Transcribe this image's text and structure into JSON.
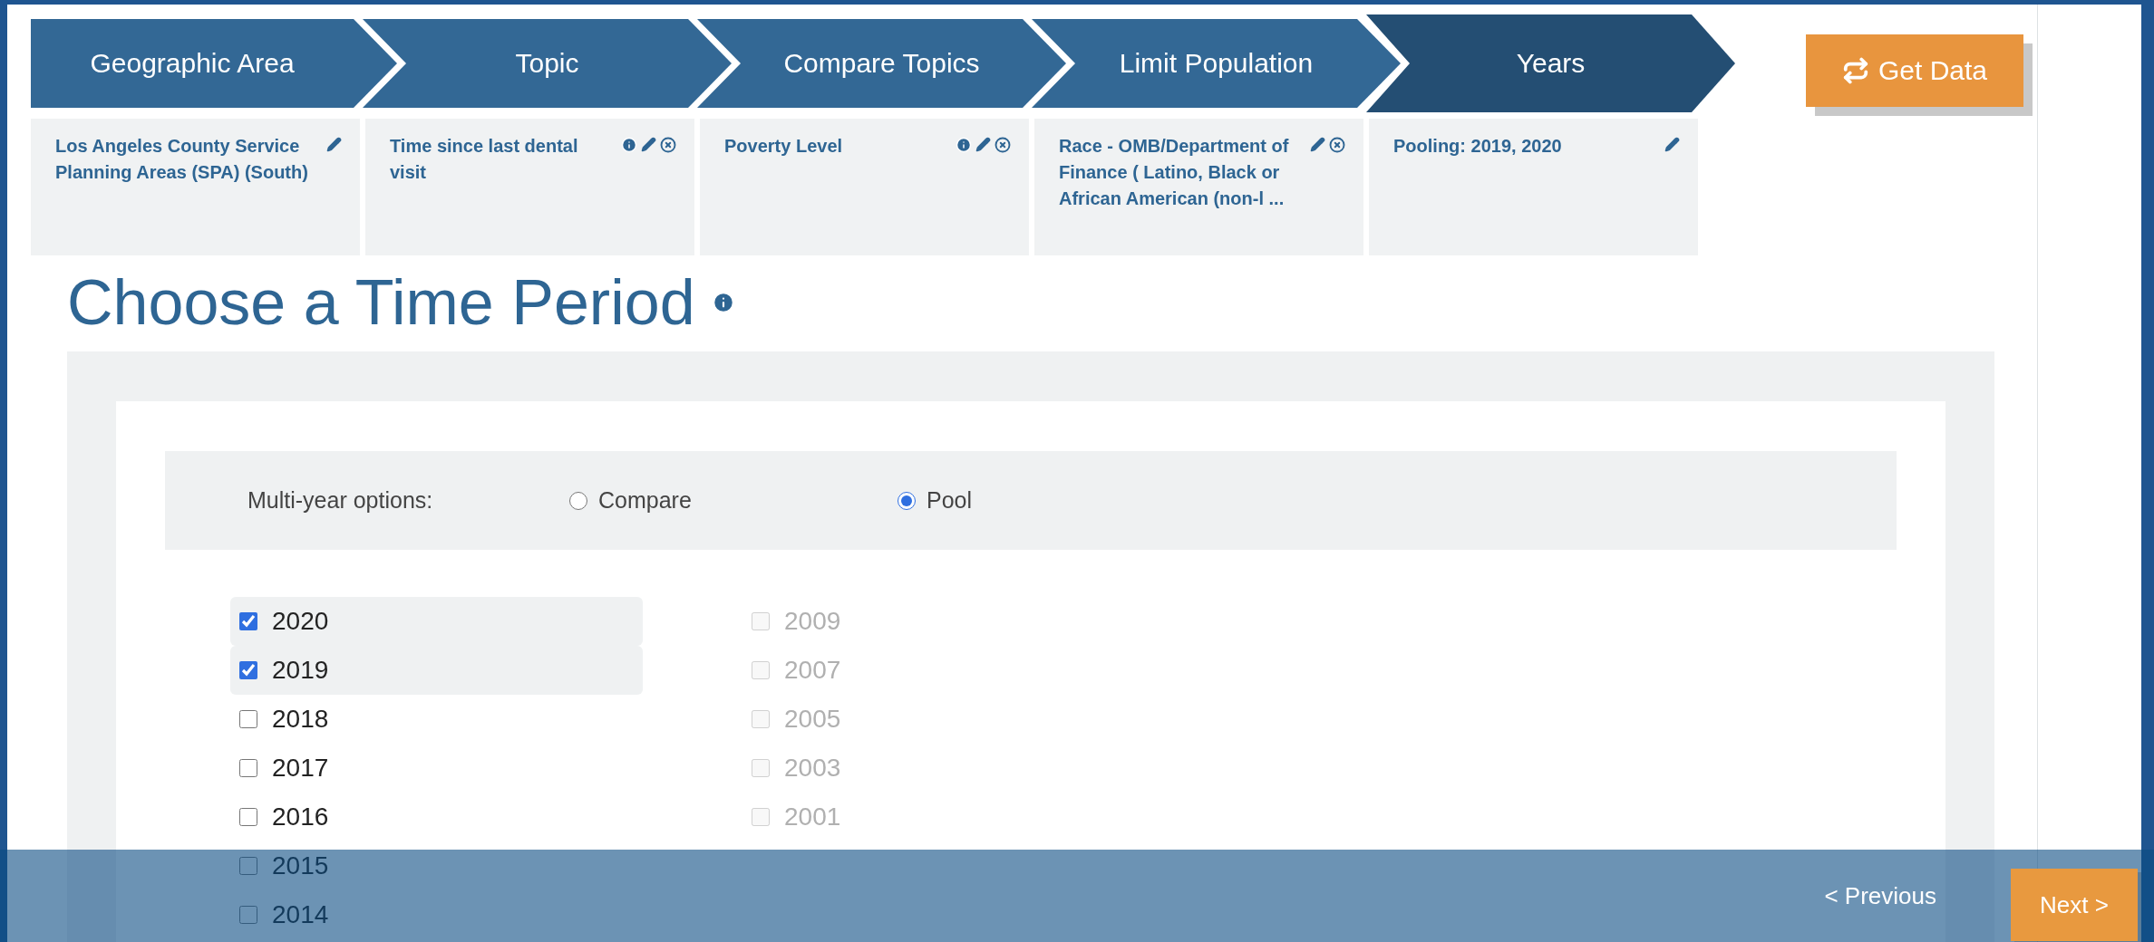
{
  "steps": [
    {
      "label": "Geographic Area",
      "selected": false
    },
    {
      "label": "Topic",
      "selected": false
    },
    {
      "label": "Compare Topics",
      "selected": false
    },
    {
      "label": "Limit Population",
      "selected": false
    },
    {
      "label": "Years",
      "selected": true
    }
  ],
  "get_data_button": {
    "label": "Get Data"
  },
  "summary_cards": [
    {
      "text": "Los Angeles County Service Planning Areas (SPA) (South)",
      "info": false,
      "edit": true,
      "remove": false
    },
    {
      "text": "Time since last dental visit",
      "info": true,
      "edit": true,
      "remove": true
    },
    {
      "text": "Poverty Level",
      "info": true,
      "edit": true,
      "remove": true
    },
    {
      "text": "Race - OMB/Department of Finance ( Latino, Black or African American (non-l ...",
      "info": false,
      "edit": true,
      "remove": true
    },
    {
      "text": "Pooling: 2019, 2020",
      "info": false,
      "edit": true,
      "remove": false
    }
  ],
  "heading": "Choose a Time Period",
  "multi_year": {
    "label": "Multi-year options:",
    "options": [
      {
        "label": "Compare",
        "selected": false
      },
      {
        "label": "Pool",
        "selected": true
      }
    ]
  },
  "year_columns": [
    [
      {
        "label": "2020",
        "checked": true,
        "disabled": false
      },
      {
        "label": "2019",
        "checked": true,
        "disabled": false
      },
      {
        "label": "2018",
        "checked": false,
        "disabled": false
      },
      {
        "label": "2017",
        "checked": false,
        "disabled": false
      },
      {
        "label": "2016",
        "checked": false,
        "disabled": false
      },
      {
        "label": "2015",
        "checked": false,
        "disabled": false
      },
      {
        "label": "2014",
        "checked": false,
        "disabled": false
      }
    ],
    [
      {
        "label": "2009",
        "checked": false,
        "disabled": true
      },
      {
        "label": "2007",
        "checked": false,
        "disabled": true
      },
      {
        "label": "2005",
        "checked": false,
        "disabled": true
      },
      {
        "label": "2003",
        "checked": false,
        "disabled": true
      },
      {
        "label": "2001",
        "checked": false,
        "disabled": true
      }
    ]
  ],
  "footer": {
    "previous": "< Previous",
    "next": "Next >"
  }
}
